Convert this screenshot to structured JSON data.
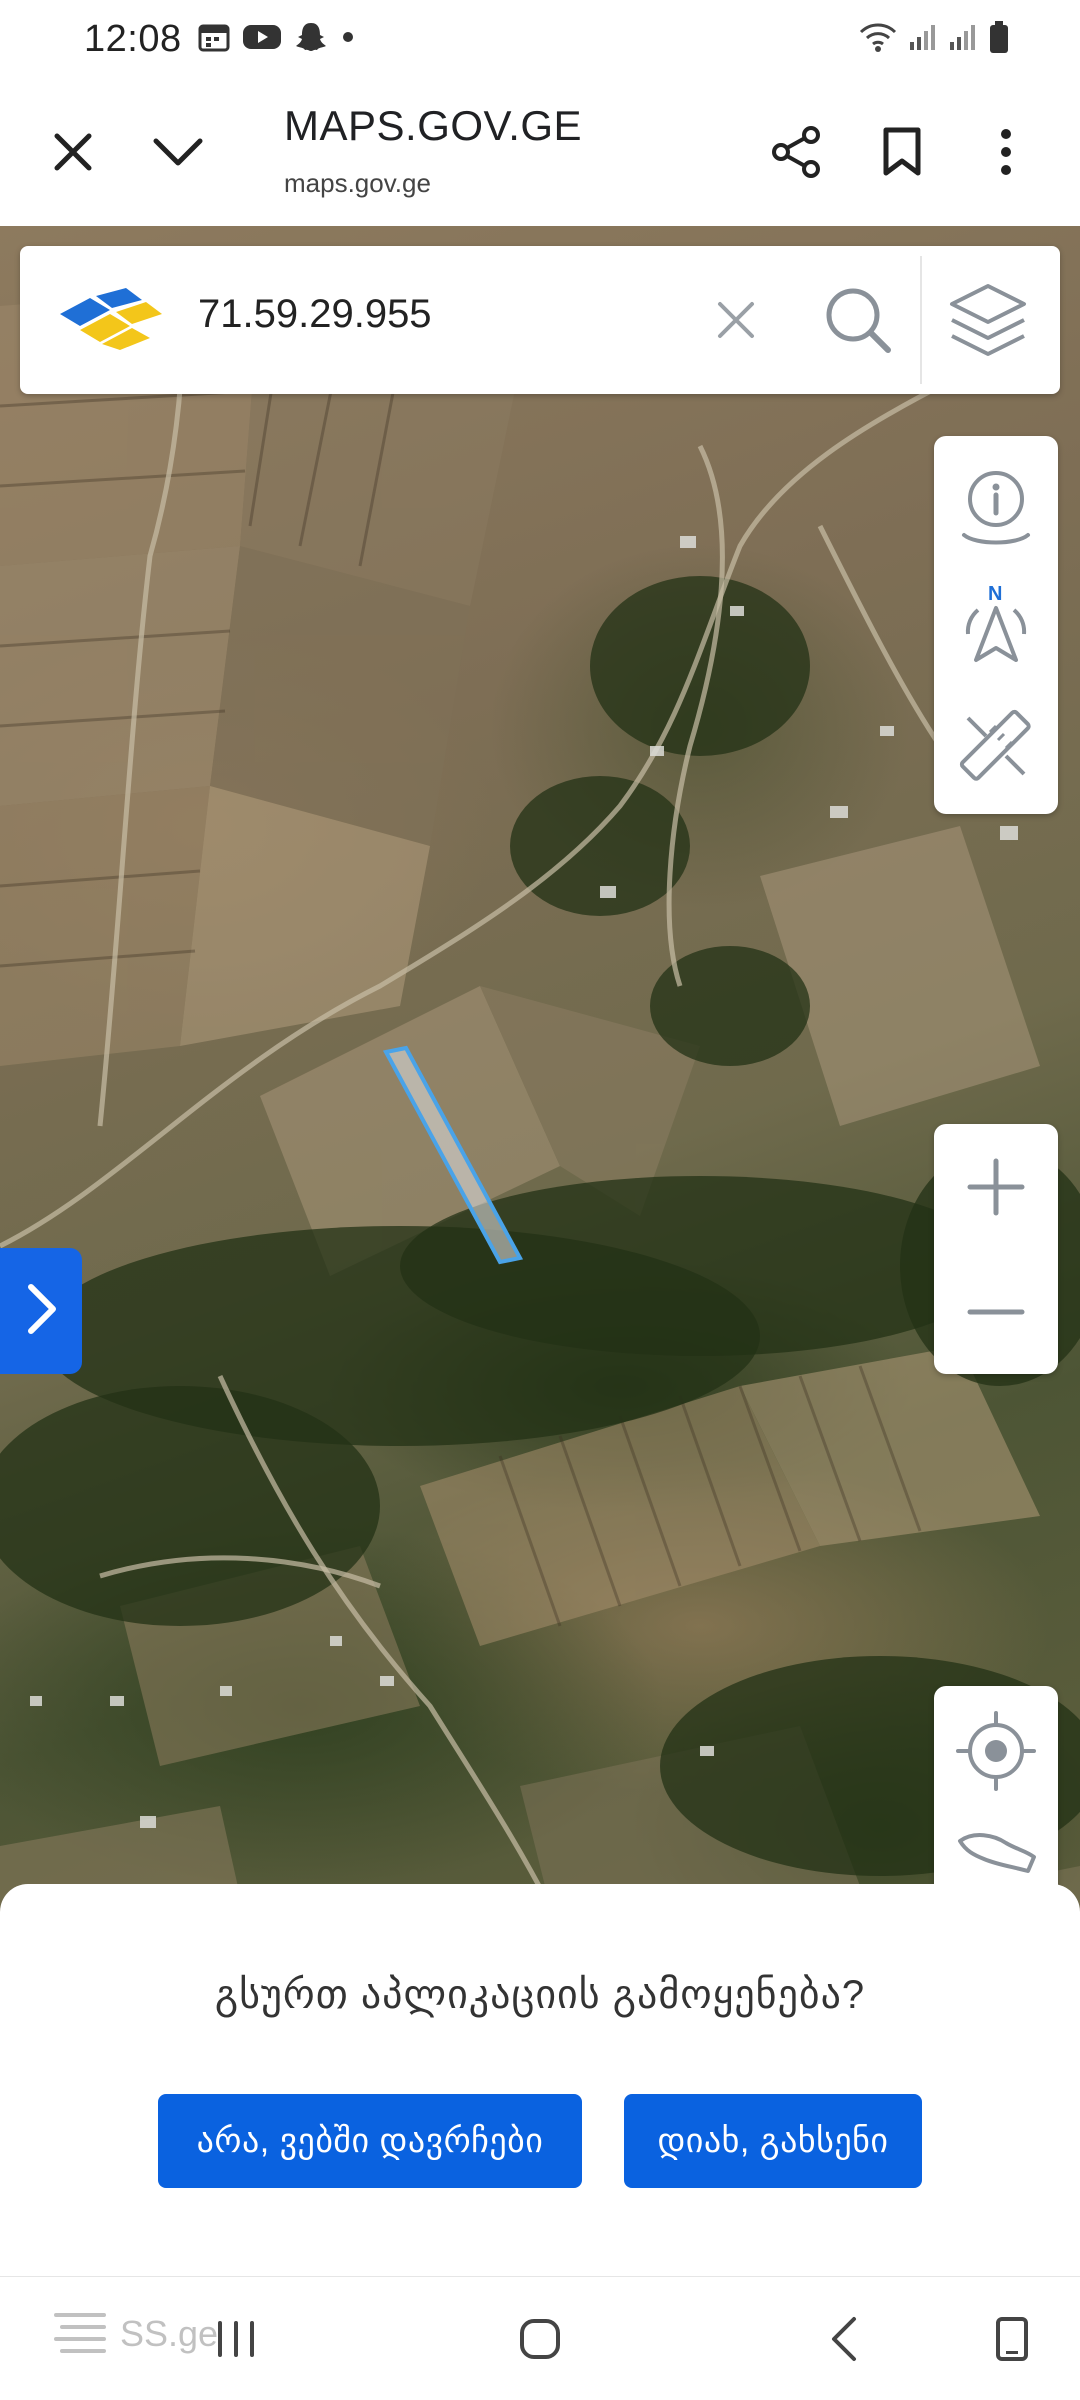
{
  "status_bar": {
    "time": "12:08",
    "icons_left": [
      "calendar-icon",
      "youtube-icon",
      "snapchat-icon",
      "dot-icon"
    ],
    "icons_right": [
      "wifi-icon",
      "signal-icon",
      "signal-icon",
      "battery-icon"
    ]
  },
  "browser": {
    "title": "MAPS.GOV.GE",
    "url": "maps.gov.ge",
    "icons": [
      "close-icon",
      "chevron-down-icon",
      "share-icon",
      "bookmark-icon",
      "more-vert-icon"
    ]
  },
  "search": {
    "value": "71.59.29.955",
    "icons": [
      "clear-icon",
      "search-icon",
      "layers-icon"
    ]
  },
  "map_tools": {
    "top_panel": [
      "info-icon",
      "compass-icon",
      "measure-icon"
    ],
    "zoom_panel": [
      "zoom-in-icon",
      "zoom-out-icon"
    ],
    "bottom_panel": [
      "locate-icon",
      "country-map-icon"
    ]
  },
  "app_prompt": {
    "question": "გსურთ აპლიკაციის გამოყენება?",
    "decline_label": "არა, ვებში დავრჩები",
    "accept_label": "დიახ, გახსენი"
  },
  "nav_bar": {
    "watermark": "SS.ge",
    "icons": [
      "recent-apps-icon",
      "home-icon",
      "back-icon",
      "rotate-icon"
    ]
  },
  "colors": {
    "primary_button": "#0a62e0",
    "side_toggle": "#1565e6",
    "parcel_outline": "#4aa3e8"
  }
}
